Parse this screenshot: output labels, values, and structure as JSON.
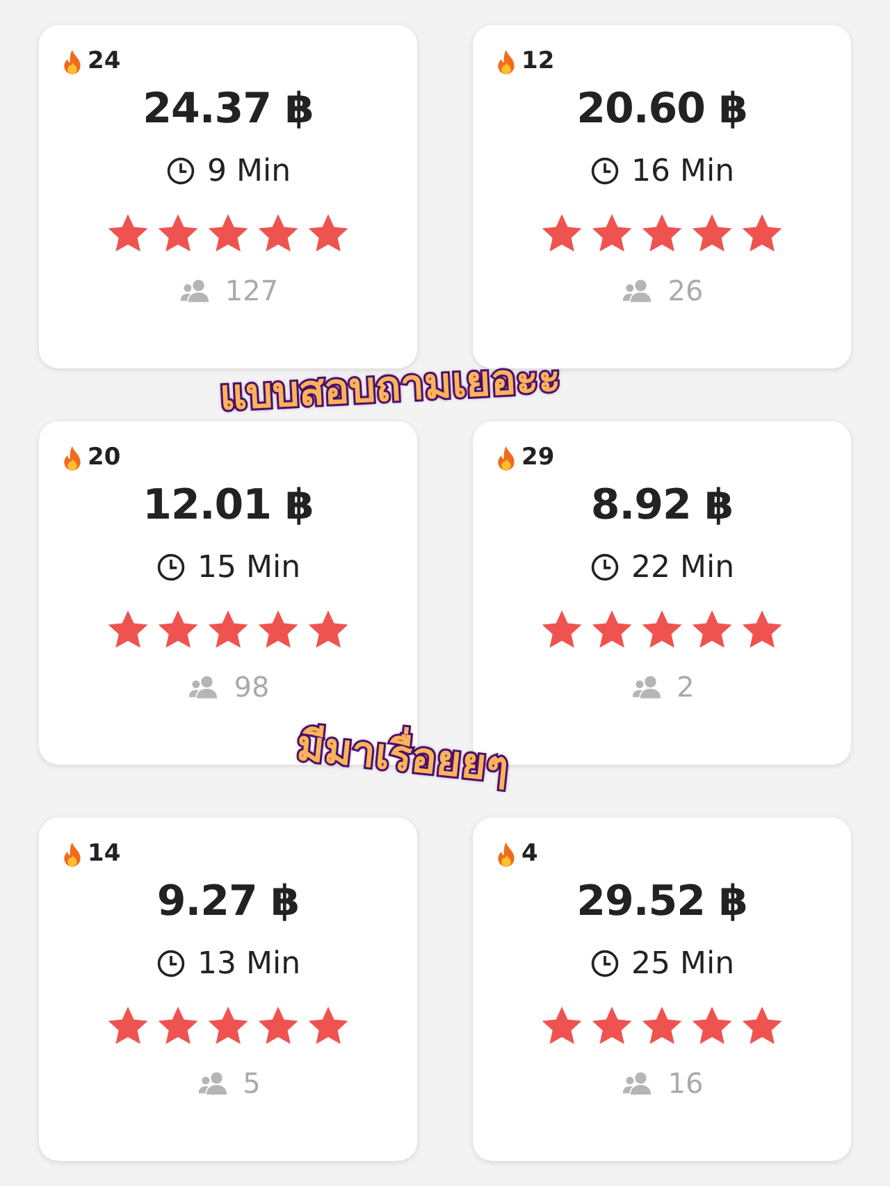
{
  "surveys": [
    {
      "hot_count": "24",
      "price": "24.37 ฿",
      "duration": "9 Min",
      "stars": 5,
      "respondents": "127"
    },
    {
      "hot_count": "12",
      "price": "20.60 ฿",
      "duration": "16 Min",
      "stars": 5,
      "respondents": "26"
    },
    {
      "hot_count": "20",
      "price": "12.01 ฿",
      "duration": "15 Min",
      "stars": 5,
      "respondents": "98"
    },
    {
      "hot_count": "29",
      "price": "8.92 ฿",
      "duration": "22 Min",
      "stars": 5,
      "respondents": "2"
    },
    {
      "hot_count": "14",
      "price": "9.27 ฿",
      "duration": "13 Min",
      "stars": 5,
      "respondents": "5"
    },
    {
      "hot_count": "4",
      "price": "29.52 ฿",
      "duration": "25 Min",
      "stars": 5,
      "respondents": "16"
    }
  ],
  "stickers": [
    "แบบสอบถามเยอะะ",
    "มีมาเรื่อยยๆ"
  ]
}
